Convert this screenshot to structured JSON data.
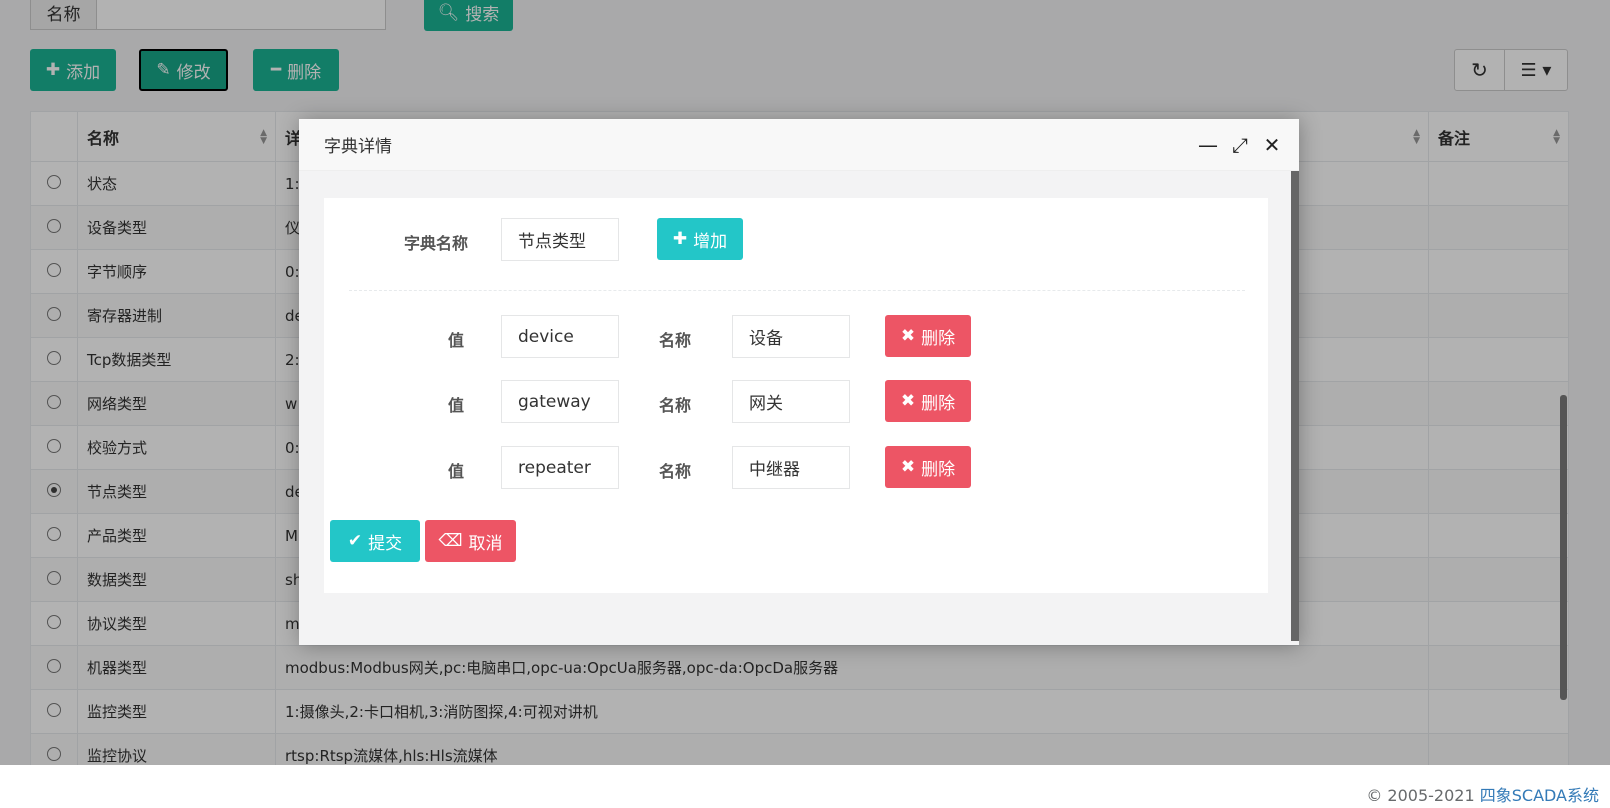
{
  "search": {
    "name_label": "名称",
    "button_label": "搜索"
  },
  "toolbar": {
    "add_label": "添加",
    "edit_label": "修改",
    "delete_label": "删除"
  },
  "table": {
    "columns": [
      "名称",
      "详",
      "备注"
    ],
    "rows": [
      {
        "name": "状态",
        "detail": "1:",
        "selected": false
      },
      {
        "name": "设备类型",
        "detail": "仪",
        "selected": false
      },
      {
        "name": "字节顺序",
        "detail": "0:",
        "selected": false
      },
      {
        "name": "寄存器进制",
        "detail": "de",
        "selected": false
      },
      {
        "name": "Tcp数据类型",
        "detail": "2:",
        "selected": false
      },
      {
        "name": "网络类型",
        "detail": "w",
        "selected": false
      },
      {
        "name": "校验方式",
        "detail": "0:",
        "selected": false
      },
      {
        "name": "节点类型",
        "detail": "de",
        "selected": true
      },
      {
        "name": "产品类型",
        "detail": "M",
        "selected": false
      },
      {
        "name": "数据类型",
        "detail": "sh",
        "selected": false
      },
      {
        "name": "协议类型",
        "detail": "m",
        "selected": false
      },
      {
        "name": "机器类型",
        "detail": "modbus:Modbus网关,pc:电脑串口,opc-ua:OpcUa服务器,opc-da:OpcDa服务器",
        "selected": false
      },
      {
        "name": "监控类型",
        "detail": "1:摄像头,2:卡口相机,3:消防图探,4:可视对讲机",
        "selected": false
      },
      {
        "name": "监控协议",
        "detail": "rtsp:Rtsp流媒体,hls:Hls流媒体",
        "selected": false
      }
    ]
  },
  "modal": {
    "title": "字典详情",
    "dict_name_label": "字典名称",
    "dict_name_value": "节点类型",
    "add_label": "增加",
    "value_label": "值",
    "name_label": "名称",
    "delete_label": "删除",
    "entries": [
      {
        "value": "device",
        "name": "设备"
      },
      {
        "value": "gateway",
        "name": "网关"
      },
      {
        "value": "repeater",
        "name": "中继器"
      }
    ],
    "submit_label": "提交",
    "cancel_label": "取消"
  },
  "footer": {
    "copyright": "© 2005-2021 ",
    "link": "四象SCADA系统"
  },
  "colors": {
    "primary": "#1ab394",
    "info": "#23c6c8",
    "danger": "#ed5565"
  },
  "icons": [
    "search-icon",
    "plus-icon",
    "edit-icon",
    "minus-icon",
    "refresh-icon",
    "columns-icon",
    "minimize-icon",
    "maximize-icon",
    "close-icon",
    "times-icon",
    "check-icon",
    "eraser-icon"
  ]
}
